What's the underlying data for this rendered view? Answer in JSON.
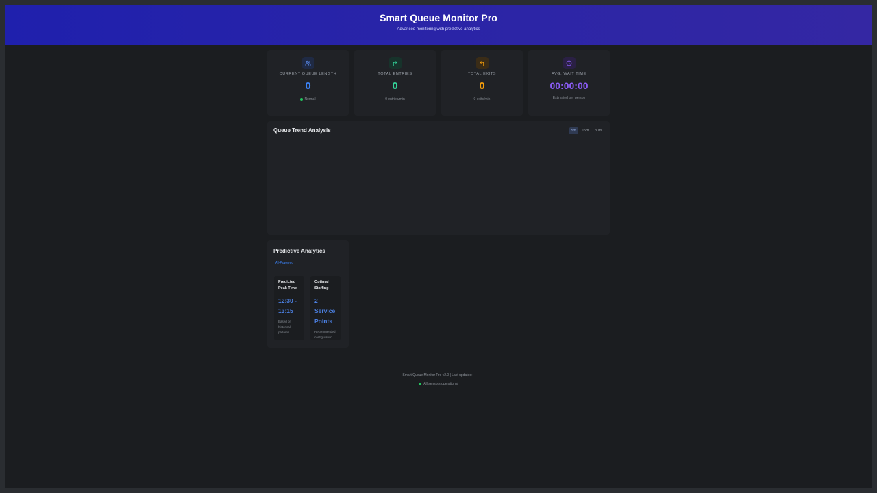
{
  "header": {
    "title": "Smart Queue Monitor Pro",
    "subtitle": "Advanced monitoring with predictive analytics"
  },
  "stats": [
    {
      "icon": "users-icon",
      "label": "CURRENT QUEUE LENGTH",
      "value": "0",
      "note": "Normal",
      "color": "#3b82f6"
    },
    {
      "icon": "entry-arrow-icon",
      "label": "TOTAL ENTRIES",
      "value": "0",
      "note": "0 entries/min",
      "color": "#34d399"
    },
    {
      "icon": "exit-arrow-icon",
      "label": "TOTAL EXITS",
      "value": "0",
      "note": "0 exits/min",
      "color": "#f59e0b"
    },
    {
      "icon": "clock-icon",
      "label": "AVG. WAIT TIME",
      "value": "00:00:00",
      "note": "Estimated per person",
      "color": "#8b5cf6"
    }
  ],
  "trend": {
    "title": "Queue Trend Analysis",
    "ranges": [
      "5m",
      "15m",
      "30m"
    ],
    "active_range": "5m"
  },
  "predictive": {
    "title": "Predictive Analytics",
    "badge": "AI-Powered",
    "peak": {
      "title": "Predicted Peak Time",
      "value": "12:30 - 13:15",
      "note": "Based on historical patterns"
    },
    "staffing": {
      "title": "Optimal Staffing",
      "value": "2 Service Points",
      "note": "Recommended configuration"
    }
  },
  "footer": {
    "version": "Smart Queue Monitor Pro v2.0 | Last updated: -",
    "status": "All sensors operational"
  },
  "colors": {
    "header_start": "#1f20ad",
    "header_end": "#3427a3",
    "background": "#1b1d20",
    "card": "#202226",
    "ok": "#22c55e"
  }
}
